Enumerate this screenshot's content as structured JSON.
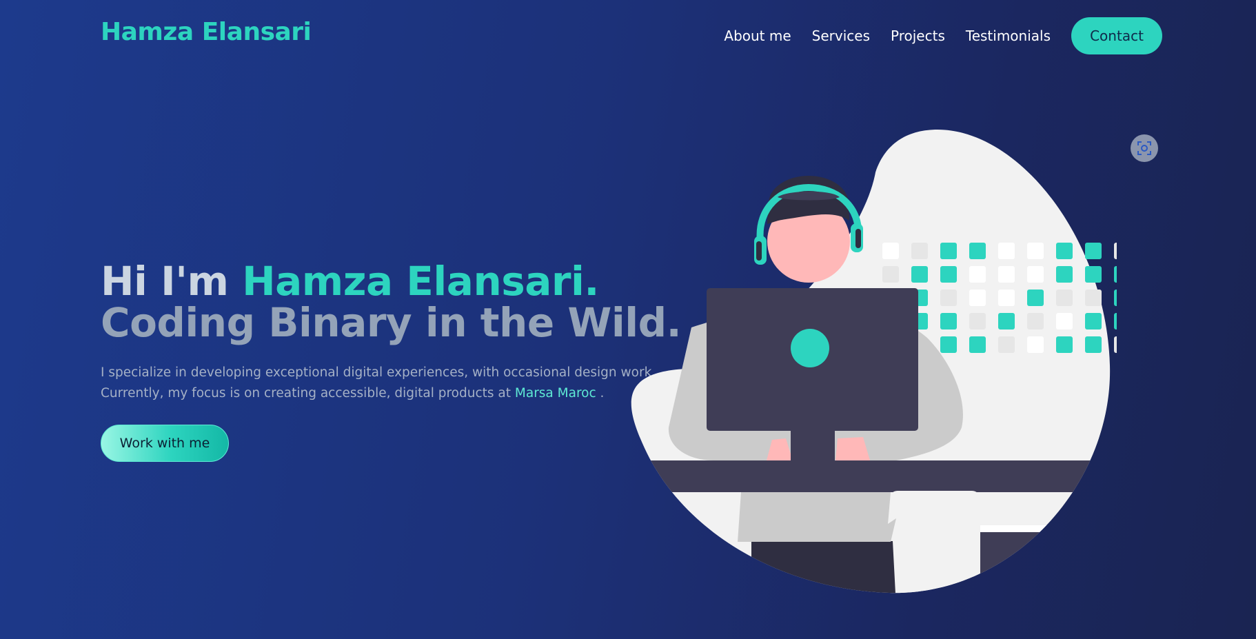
{
  "header": {
    "logo": "Hamza Elansari",
    "nav": [
      {
        "label": "About me"
      },
      {
        "label": "Services"
      },
      {
        "label": "Projects"
      },
      {
        "label": "Testimonials"
      }
    ],
    "contact_label": "Contact"
  },
  "hero": {
    "greeting": "Hi I'm",
    "name": "Hamza Elansari.",
    "tagline": "Coding Binary in the Wild.",
    "description_line1": "I specialize in developing exceptional digital experiences, with occasional design work.",
    "description_line2": "Currently, my focus is on creating accessible, digital products at",
    "company": "Marsa Maroc",
    "description_end": ".",
    "cta_label": "Work with me"
  },
  "colors": {
    "accent": "#2dd4bf",
    "background_start": "#1d3a8c",
    "background_end": "#1a2452",
    "heading": "#cbd5e1",
    "subheading": "#94a3b8"
  },
  "icons": {
    "focus": "focus-scan-icon"
  }
}
